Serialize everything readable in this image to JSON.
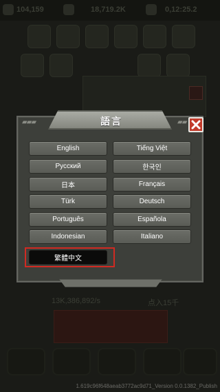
{
  "background": {
    "stat_left": "104,159",
    "stat_mid": "18,719.2K",
    "stat_right": "0,12:25.2",
    "stat_lower_left": "13K,386,892/s",
    "stat_lower_right": "点入15千",
    "build_info": "1.619c96f648aeab3772ac9d71_Version 0.0.1382_Publish"
  },
  "dialog": {
    "title": "語言",
    "close_icon": "close-icon",
    "languages": [
      {
        "label": "English"
      },
      {
        "label": "Tiếng Việt"
      },
      {
        "label": "Русский"
      },
      {
        "label": "한국인"
      },
      {
        "label": "日本"
      },
      {
        "label": "Français"
      },
      {
        "label": "Türk"
      },
      {
        "label": "Deutsch"
      },
      {
        "label": "Português"
      },
      {
        "label": "Española"
      },
      {
        "label": "Indonesian"
      },
      {
        "label": "Italiano"
      },
      {
        "label": "繁體中文",
        "selected": true
      }
    ]
  },
  "colors": {
    "selection_outline": "#d12a22",
    "close_button": "#c23b2b"
  }
}
